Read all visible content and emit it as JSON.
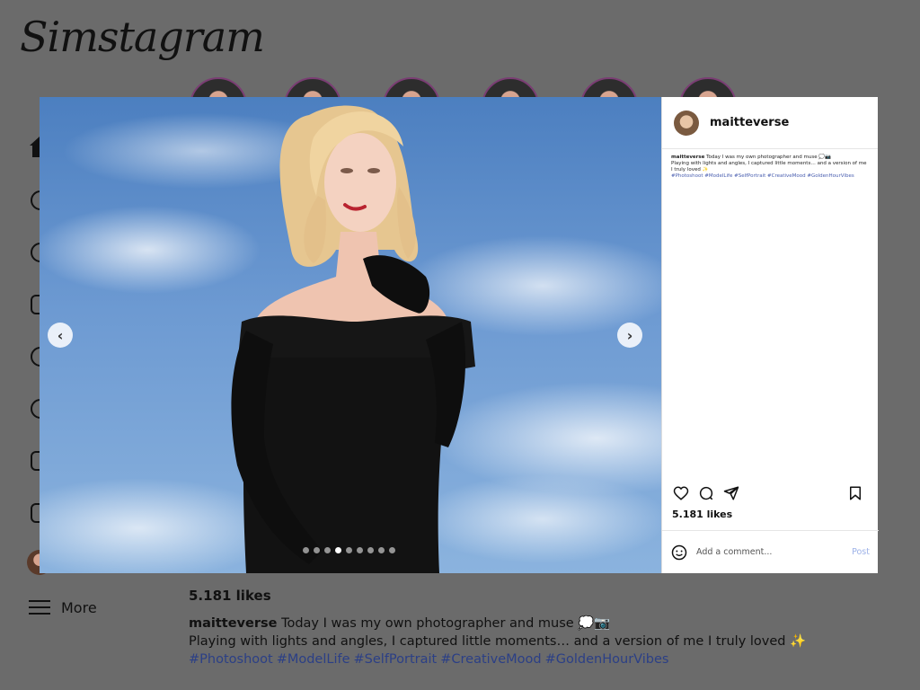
{
  "app": {
    "title": "Simstagram"
  },
  "sidebar": {
    "more_label": "More"
  },
  "post": {
    "username": "maitteverse",
    "caption_line1": "Today I was my own photographer and muse 💭📷",
    "caption_line2": "Playing with lights and angles, I captured little moments… and a version of me I truly loved ✨",
    "hashtags": [
      "#Photoshoot",
      "#ModelLife",
      "#SelfPortrait",
      "#CreativeMood",
      "#GoldenHourVibes"
    ],
    "likes": "5.181 likes",
    "carousel": {
      "total": 9,
      "current": 4
    },
    "comment": {
      "placeholder": "Add a comment...",
      "post_label": "Post"
    }
  },
  "icons": {
    "prev": "chevron-left-icon",
    "next": "chevron-right-icon",
    "like": "heart-icon",
    "comment": "comment-icon",
    "share": "send-icon",
    "save": "bookmark-icon",
    "emoji": "emoji-icon"
  },
  "colors": {
    "accent": "#9db2e8",
    "hashtag": "#4a5fb0"
  }
}
